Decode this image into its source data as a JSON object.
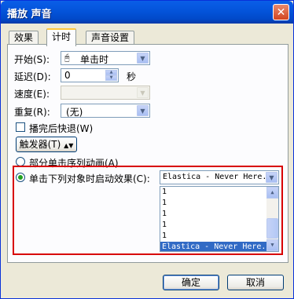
{
  "window": {
    "title": "播放 声音",
    "close_symbol": "✕"
  },
  "tabs": [
    {
      "label": "效果"
    },
    {
      "label": "计时"
    },
    {
      "label": "声音设置"
    }
  ],
  "timing": {
    "start_label": "开始(S):",
    "start_value": "单击时",
    "delay_label": "延迟(D):",
    "delay_value": "0",
    "delay_unit": "秒",
    "speed_label": "速度(E):",
    "speed_value": "",
    "repeat_label": "重复(R):",
    "repeat_value": "(无)",
    "rewind_label": "播完后快退(W)",
    "rewind_checked": false,
    "triggers_button": "触发器(T)"
  },
  "trigger": {
    "option_sequence_label": "部分单击序列动画(A)",
    "option_sequence_selected": false,
    "option_object_label": "单击下列对象时启动效果(C):",
    "option_object_selected": true,
    "object_value": "Elastica - Never Here.",
    "list_items": [
      "1",
      "1",
      "1",
      "1",
      "1",
      "Elastica - Never Here."
    ],
    "selected_index": 5
  },
  "buttons": {
    "ok": "确定",
    "cancel": "取消"
  }
}
